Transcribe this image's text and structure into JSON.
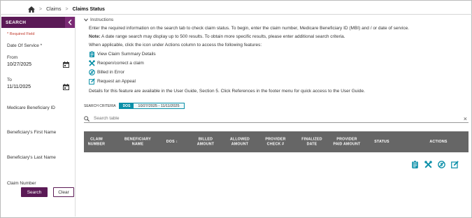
{
  "breadcrumb": {
    "items": [
      "Claims",
      "Claims Status"
    ],
    "separator": ">"
  },
  "sidebar": {
    "title": "SEARCH",
    "required_note": "* Required Field",
    "date_of_service_label": "Date Of Service *",
    "from_label": "From",
    "from_value": "10/27/2025",
    "to_label": "To",
    "to_value": "11/11/2025",
    "mbi_label": "Medicare Beneficiary ID",
    "first_name_label": "Beneficiary's First Name",
    "last_name_label": "Beneficiary's Last Name",
    "claim_number_label": "Claim Number",
    "search_button": "Search",
    "clear_button": "Clear"
  },
  "instructions": {
    "toggle_label": "Instructions",
    "line1": "Enter the required information on the search tab to check claim status. To begin, enter the claim number, Medicare Beneficiary ID (MBI) and / or date of service.",
    "note_prefix": "Note:",
    "note_text": " A date range search may display up to 500 results. To obtain more specific results, please enter additional search criteria.",
    "line3": "When applicable, click the icon under Actions column to access the following features:",
    "actions": [
      {
        "label": "View Claim Summary Details",
        "icon": "clipboard-icon"
      },
      {
        "label": "Reopen/correct a claim",
        "icon": "tools-icon"
      },
      {
        "label": "Billed in Error",
        "icon": "no-dollar-icon"
      },
      {
        "label": "Request an Appeal",
        "icon": "edit-icon"
      }
    ],
    "footer": "Details for this feature are available in the User Guide, Section 5. Click References in the footer menu for quick access to the User Guide."
  },
  "search_criteria": {
    "label": "SEARCH CRITERIA",
    "tag": "DOS",
    "value": "10/27/2025 - 11/11/2025"
  },
  "table_search": {
    "placeholder": "Search table",
    "clear": "×"
  },
  "table": {
    "headers": [
      "CLAIM NUMBER",
      "BENEFICIARY NAME",
      "DOS",
      "BILLED AMOUNT",
      "ALLOWED AMOUNT",
      "PROVIDER CHECK #",
      "FINALIZED DATE",
      "PROVIDER PAID AMOUNT",
      "STATUS",
      "ACTIONS"
    ],
    "row_action_icons": [
      "clipboard-icon",
      "tools-icon",
      "no-dollar-icon",
      "edit-icon"
    ]
  },
  "colors": {
    "brand": "#5b1a56",
    "accent": "#0a8fa8",
    "header_bg": "#666666",
    "required": "#c0392b"
  }
}
